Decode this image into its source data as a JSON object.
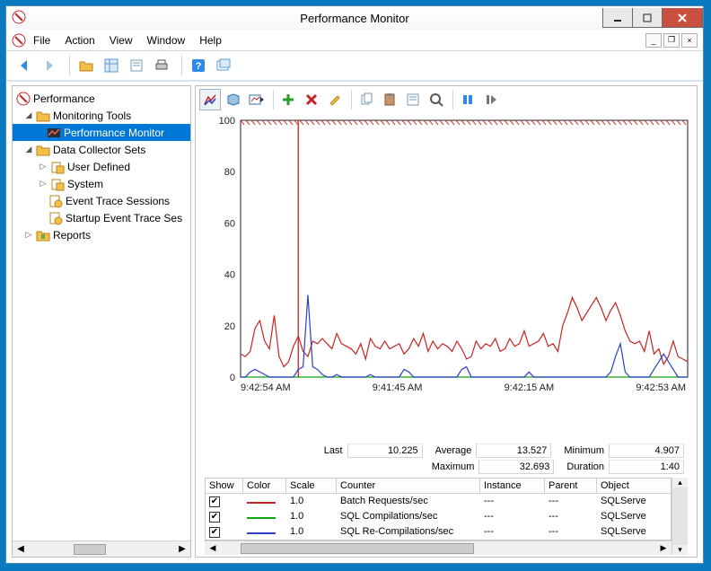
{
  "window": {
    "title": "Performance Monitor"
  },
  "menu": [
    "File",
    "Action",
    "View",
    "Window",
    "Help"
  ],
  "tree": {
    "root": "Performance",
    "mtools": "Monitoring Tools",
    "perfmon": "Performance Monitor",
    "dcs": "Data Collector Sets",
    "ud": "User Defined",
    "sys": "System",
    "ets": "Event Trace Sessions",
    "sets": "Startup Event Trace Ses",
    "reports": "Reports"
  },
  "chart_data": {
    "type": "line",
    "ylim": [
      0,
      100
    ],
    "xlabels": [
      "9:42:54 AM",
      "9:41:45 AM",
      "9:42:15 AM",
      "9:42:53 AM"
    ],
    "series": [
      {
        "name": "Batch Requests/sec",
        "color": "#c52424",
        "values": [
          9,
          8,
          10,
          19,
          22,
          14,
          11,
          24,
          8,
          4,
          6,
          12,
          16,
          10,
          8,
          14,
          13,
          15,
          13,
          11,
          17,
          13,
          12,
          11,
          9,
          13,
          7,
          15,
          12,
          11,
          14,
          11,
          12,
          13,
          9,
          11,
          15,
          12,
          17,
          10,
          14,
          11,
          13,
          12,
          10,
          14,
          11,
          7,
          8,
          14,
          11,
          13,
          12,
          15,
          10,
          11,
          15,
          12,
          13,
          18,
          12,
          13,
          14,
          17,
          12,
          13,
          10,
          20,
          25,
          31,
          27,
          22,
          25,
          28,
          31,
          27,
          22,
          26,
          29,
          24,
          18,
          14,
          13,
          14,
          10,
          18,
          9,
          11,
          5,
          8,
          14,
          8,
          7,
          6
        ]
      },
      {
        "name": "SQL Compilations/sec",
        "color": "#11a611",
        "values": [
          0,
          0,
          0,
          0,
          0,
          0,
          0,
          0,
          0,
          0,
          0,
          0,
          0,
          0,
          0,
          0,
          0,
          0,
          0,
          0,
          0,
          0,
          0,
          0,
          0,
          0,
          0,
          0,
          0,
          0,
          0,
          0,
          0,
          0,
          0,
          0,
          0,
          0,
          0,
          0,
          0,
          0,
          0,
          0,
          0,
          0,
          0,
          0,
          0,
          0,
          0,
          0,
          0,
          0,
          0,
          0,
          0,
          0,
          0,
          0,
          0,
          0,
          0,
          0,
          0,
          0,
          0,
          0,
          0,
          0,
          0,
          0,
          0,
          0,
          0,
          0,
          0,
          0,
          0,
          0,
          0,
          0,
          0,
          0,
          0,
          0,
          0,
          0,
          0,
          0,
          0,
          0,
          0,
          0
        ]
      },
      {
        "name": "SQL Re-Compilations/sec",
        "color": "#2b3fc7",
        "values": [
          0,
          0,
          2,
          3,
          2,
          1,
          0,
          0,
          0,
          0,
          0,
          0,
          3,
          4,
          32,
          4,
          3,
          1,
          0,
          0,
          1,
          0,
          0,
          0,
          0,
          0,
          0,
          1,
          0,
          0,
          0,
          0,
          0,
          0,
          3,
          2,
          0,
          0,
          0,
          0,
          0,
          0,
          0,
          0,
          0,
          0,
          3,
          4,
          0,
          0,
          0,
          0,
          0,
          0,
          0,
          0,
          0,
          0,
          0,
          0,
          2,
          0,
          0,
          0,
          0,
          0,
          0,
          0,
          0,
          0,
          0,
          0,
          0,
          0,
          0,
          0,
          0,
          2,
          8,
          13,
          2,
          0,
          0,
          0,
          0,
          0,
          3,
          6,
          9,
          6,
          3,
          0,
          0,
          0
        ]
      }
    ],
    "cursor_x": 12
  },
  "stats": {
    "last_lbl": "Last",
    "avg_lbl": "Average",
    "min_lbl": "Minimum",
    "max_lbl": "Maximum",
    "dur_lbl": "Duration",
    "last": "10.225",
    "average": "13.527",
    "minimum": "4.907",
    "maximum": "32.693",
    "duration": "1:40"
  },
  "grid": {
    "hdr": {
      "show": "Show",
      "color": "Color",
      "scale": "Scale",
      "counter": "Counter",
      "instance": "Instance",
      "parent": "Parent",
      "object": "Object"
    },
    "rows": [
      {
        "color": "#c52424",
        "scale": "1.0",
        "counter": "Batch Requests/sec",
        "instance": "---",
        "parent": "---",
        "object": "SQLServe"
      },
      {
        "color": "#11a611",
        "scale": "1.0",
        "counter": "SQL Compilations/sec",
        "instance": "---",
        "parent": "---",
        "object": "SQLServe"
      },
      {
        "color": "#2b3fc7",
        "scale": "1.0",
        "counter": "SQL Re-Compilations/sec",
        "instance": "---",
        "parent": "---",
        "object": "SQLServe"
      }
    ]
  }
}
